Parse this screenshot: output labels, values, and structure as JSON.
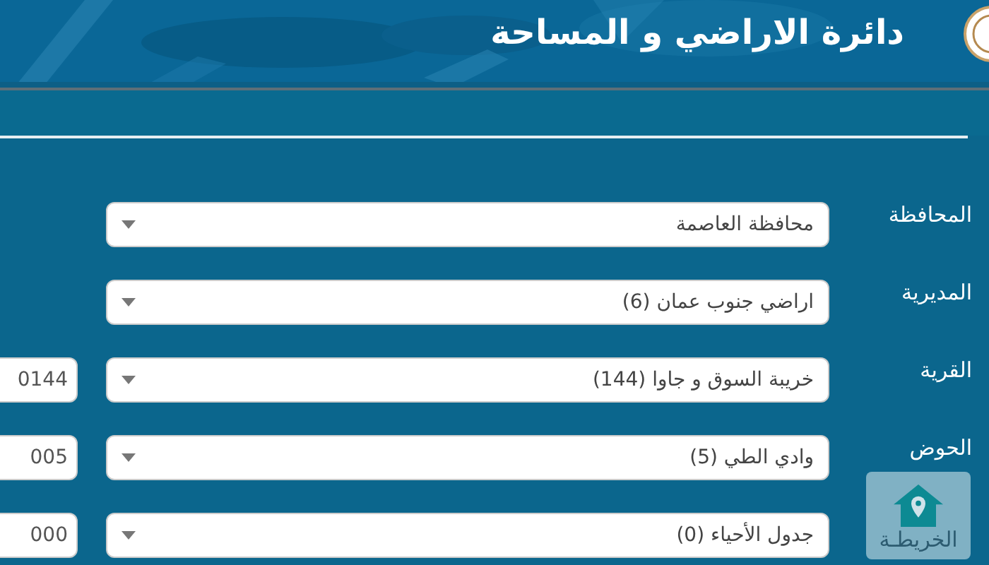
{
  "header": {
    "title": "دائرة الاراضي و المساحة"
  },
  "form": {
    "rows": [
      {
        "label": "المحافظة",
        "value": "محافظة العاصمة"
      },
      {
        "label": "المديرية",
        "value": "اراضي جنوب عمان (6)"
      },
      {
        "label": "القرية",
        "value": "خريبة السوق و جاوا (144)",
        "code": "0144"
      },
      {
        "label": "الحوض",
        "value": "وادي الطي (5)",
        "code": "005"
      },
      {
        "value": "جدول الأحياء (0)",
        "code": "000"
      }
    ]
  },
  "map_button": {
    "label": "الخريطـة"
  }
}
